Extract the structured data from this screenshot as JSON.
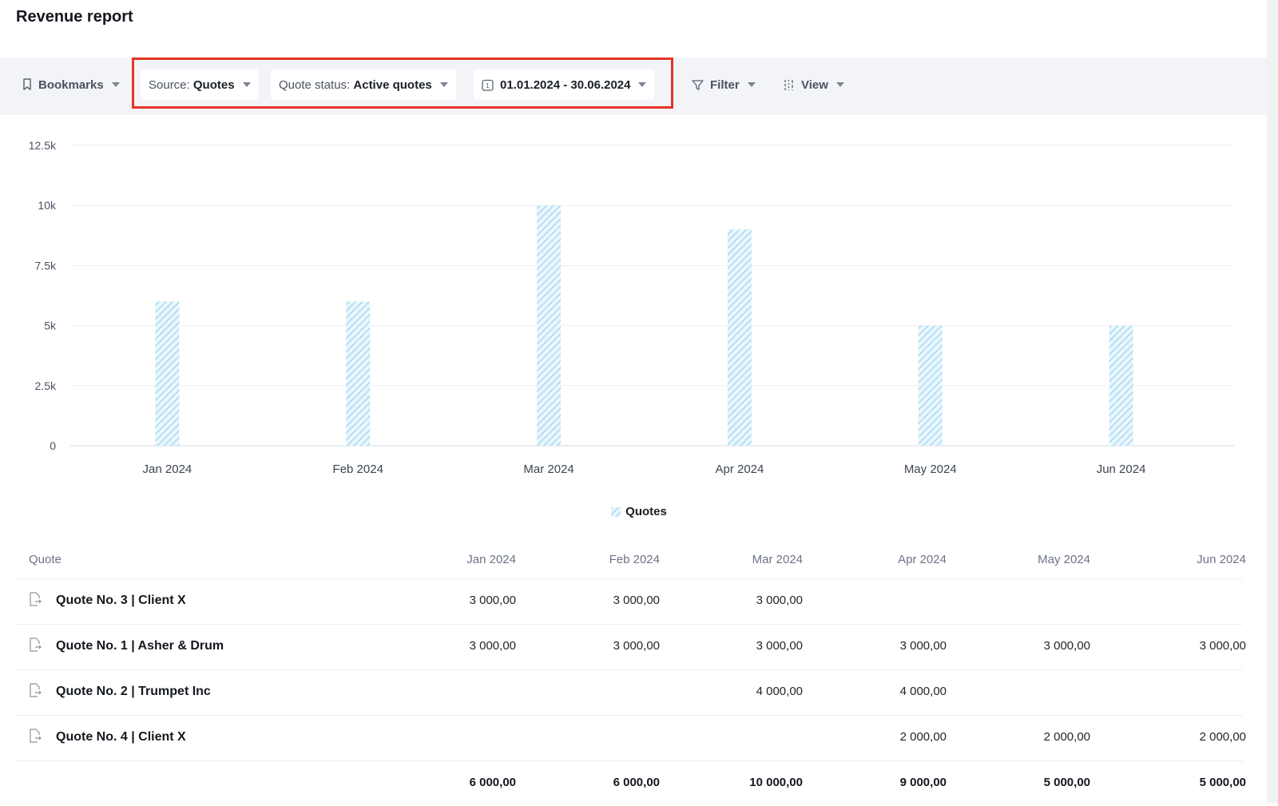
{
  "title": "Revenue report",
  "toolbar": {
    "bookmarks": "Bookmarks",
    "source_label": "Source:",
    "source_value": "Quotes",
    "status_label": "Quote status:",
    "status_value": "Active quotes",
    "date_range": "01.01.2024 - 30.06.2024",
    "filter": "Filter",
    "view": "View"
  },
  "chart_data": {
    "type": "bar",
    "categories": [
      "Jan 2024",
      "Feb 2024",
      "Mar 2024",
      "Apr 2024",
      "May 2024",
      "Jun 2024"
    ],
    "series": [
      {
        "name": "Quotes",
        "values": [
          6000,
          6000,
          10000,
          9000,
          5000,
          5000
        ]
      }
    ],
    "ylim": [
      0,
      12500
    ],
    "yticks": [
      0,
      2500,
      5000,
      7500,
      10000,
      12500
    ],
    "ytick_labels": [
      "0",
      "2.5k",
      "5k",
      "7.5k",
      "10k",
      "12.5k"
    ],
    "grid": true,
    "legend": "bottom-center",
    "bar_color": "#bfe3f5"
  },
  "table": {
    "columns": [
      "Quote",
      "Jan 2024",
      "Feb 2024",
      "Mar 2024",
      "Apr 2024",
      "May 2024",
      "Jun 2024"
    ],
    "rows": [
      {
        "name": "Quote No. 3 | Client X",
        "values": [
          "3 000,00",
          "3 000,00",
          "3 000,00",
          "",
          "",
          ""
        ]
      },
      {
        "name": "Quote No. 1 | Asher & Drum",
        "values": [
          "3 000,00",
          "3 000,00",
          "3 000,00",
          "3 000,00",
          "3 000,00",
          "3 000,00"
        ]
      },
      {
        "name": "Quote No. 2 | Trumpet Inc",
        "values": [
          "",
          "",
          "4 000,00",
          "4 000,00",
          "",
          ""
        ]
      },
      {
        "name": "Quote No. 4 | Client X",
        "values": [
          "",
          "",
          "",
          "2 000,00",
          "2 000,00",
          "2 000,00"
        ]
      }
    ],
    "totals": [
      "6 000,00",
      "6 000,00",
      "10 000,00",
      "9 000,00",
      "5 000,00",
      "5 000,00"
    ]
  }
}
